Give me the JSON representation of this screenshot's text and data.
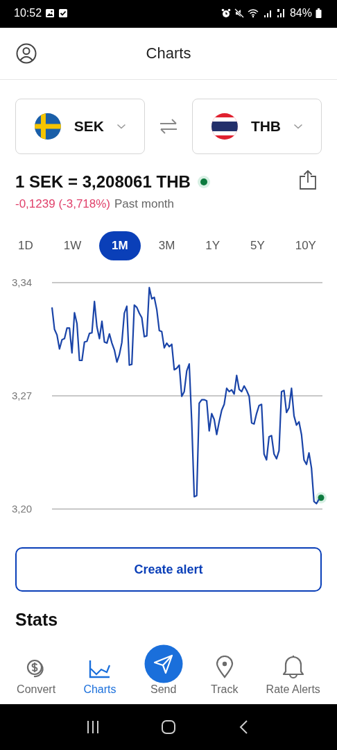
{
  "status_bar": {
    "time": "10:52",
    "battery": "84%"
  },
  "header": {
    "title": "Charts"
  },
  "pair": [
    {
      "code": "SEK",
      "kind": "se"
    },
    {
      "code": "THB",
      "kind": "th"
    }
  ],
  "rate": {
    "text": "1 SEK = 3,208061 THB",
    "live": true
  },
  "change": {
    "value": "-0,1239 (-3,718%)",
    "period": "Past month"
  },
  "ranges": [
    {
      "label": "1D",
      "selected": false
    },
    {
      "label": "1W",
      "selected": false
    },
    {
      "label": "1M",
      "selected": true
    },
    {
      "label": "3M",
      "selected": false
    },
    {
      "label": "1Y",
      "selected": false
    },
    {
      "label": "5Y",
      "selected": false
    },
    {
      "label": "10Y",
      "selected": false
    }
  ],
  "chart_data": {
    "type": "line",
    "ylim": [
      3.2,
      3.34
    ],
    "yticks": [
      {
        "value": 3.34,
        "label": "3,34"
      },
      {
        "value": 3.27,
        "label": "3,27"
      },
      {
        "value": 3.2,
        "label": "3,20"
      }
    ],
    "series": [
      {
        "color": "#1a44a8",
        "values": [
          3.3247,
          3.3111,
          3.3076,
          3.299,
          3.3047,
          3.3054,
          3.3119,
          3.3119,
          3.2966,
          3.3214,
          3.3147,
          3.2919,
          3.2919,
          3.3033,
          3.3037,
          3.3086,
          3.309,
          3.3283,
          3.3126,
          3.3054,
          3.3161,
          3.3033,
          3.3026,
          3.3083,
          3.3026,
          3.2983,
          3.2909,
          3.2954,
          3.3029,
          3.3211,
          3.3254,
          3.289,
          3.2894,
          3.3261,
          3.3247,
          3.3211,
          3.3183,
          3.3066,
          3.3071,
          3.3369,
          3.33,
          3.3309,
          3.3233,
          3.3104,
          3.3097,
          3.2997,
          3.3026,
          3.3004,
          3.3019,
          3.2861,
          3.2871,
          3.289,
          3.2697,
          3.2726,
          3.2854,
          3.2897,
          3.254,
          3.2076,
          3.2083,
          3.2654,
          3.2676,
          3.2676,
          3.2669,
          3.2483,
          3.259,
          3.2554,
          3.2461,
          3.254,
          3.2611,
          3.2647,
          3.2747,
          3.2726,
          3.2737,
          3.2711,
          3.2826,
          3.274,
          3.2726,
          3.2761,
          3.2733,
          3.2697,
          3.2533,
          3.2526,
          3.259,
          3.264,
          3.2647,
          3.234,
          3.2304,
          3.2447,
          3.2454,
          3.234,
          3.2311,
          3.2361,
          3.2726,
          3.2733,
          3.2597,
          3.2626,
          3.2747,
          3.2576,
          3.2519,
          3.254,
          3.2461,
          3.2304,
          3.2276,
          3.2347,
          3.2254,
          3.2047,
          3.2033,
          3.2061
        ]
      }
    ]
  },
  "create_alert": "Create alert",
  "stats_title": "Stats",
  "nav": [
    {
      "label": "Convert",
      "kind": "convert",
      "selected": false
    },
    {
      "label": "Charts",
      "kind": "charts",
      "selected": true
    },
    {
      "label": "Send",
      "kind": "send",
      "selected": false
    },
    {
      "label": "Track",
      "kind": "track",
      "selected": false
    },
    {
      "label": "Rate Alerts",
      "kind": "alerts",
      "selected": false
    }
  ]
}
